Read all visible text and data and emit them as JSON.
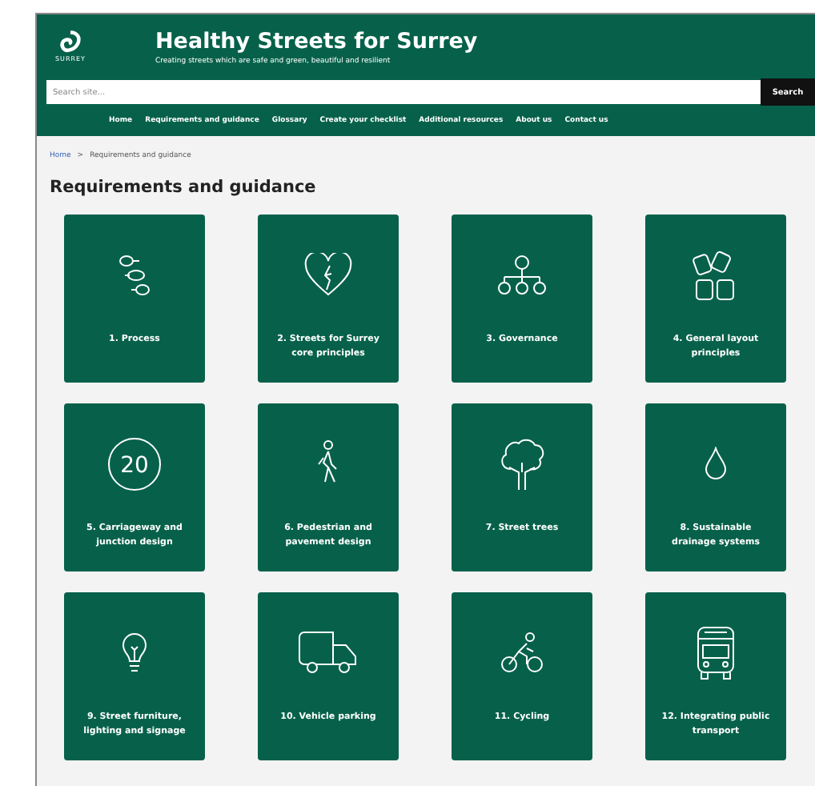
{
  "header": {
    "logo_text": "SURREY",
    "title": "Healthy Streets for Surrey",
    "tagline": "Creating streets which are safe and green, beautiful and resilient"
  },
  "search": {
    "placeholder": "Search site...",
    "button": "Search"
  },
  "nav": [
    "Home",
    "Requirements and guidance",
    "Glossary",
    "Create your checklist",
    "Additional resources",
    "About us",
    "Contact us"
  ],
  "breadcrumb": [
    {
      "label": "Home",
      "kind": "link"
    },
    {
      "label": ">",
      "kind": "separator"
    },
    {
      "label": "Requirements and guidance",
      "kind": "current"
    }
  ],
  "heading": "Requirements and guidance",
  "cards": [
    {
      "label": "1. Process",
      "kind": "flow"
    },
    {
      "label": "2. Streets for Surrey core principles",
      "kind": "heart"
    },
    {
      "label": "3. Governance",
      "kind": "hierarchy"
    },
    {
      "label": "4. General layout principles",
      "kind": "tiles"
    },
    {
      "label": "5. Carriageway and junction design",
      "kind": "speed",
      "icon_text": "20"
    },
    {
      "label": "6. Pedestrian and pavement design",
      "kind": "walker"
    },
    {
      "label": "7. Street trees",
      "kind": "tree"
    },
    {
      "label": "8. Sustainable drainage systems",
      "kind": "drop"
    },
    {
      "label": "9. Street furniture, lighting and signage",
      "kind": "bulb"
    },
    {
      "label": "10. Vehicle parking",
      "kind": "van"
    },
    {
      "label": "11. Cycling",
      "kind": "cyclist"
    },
    {
      "label": "12. Integrating public transport",
      "kind": "bus"
    }
  ]
}
